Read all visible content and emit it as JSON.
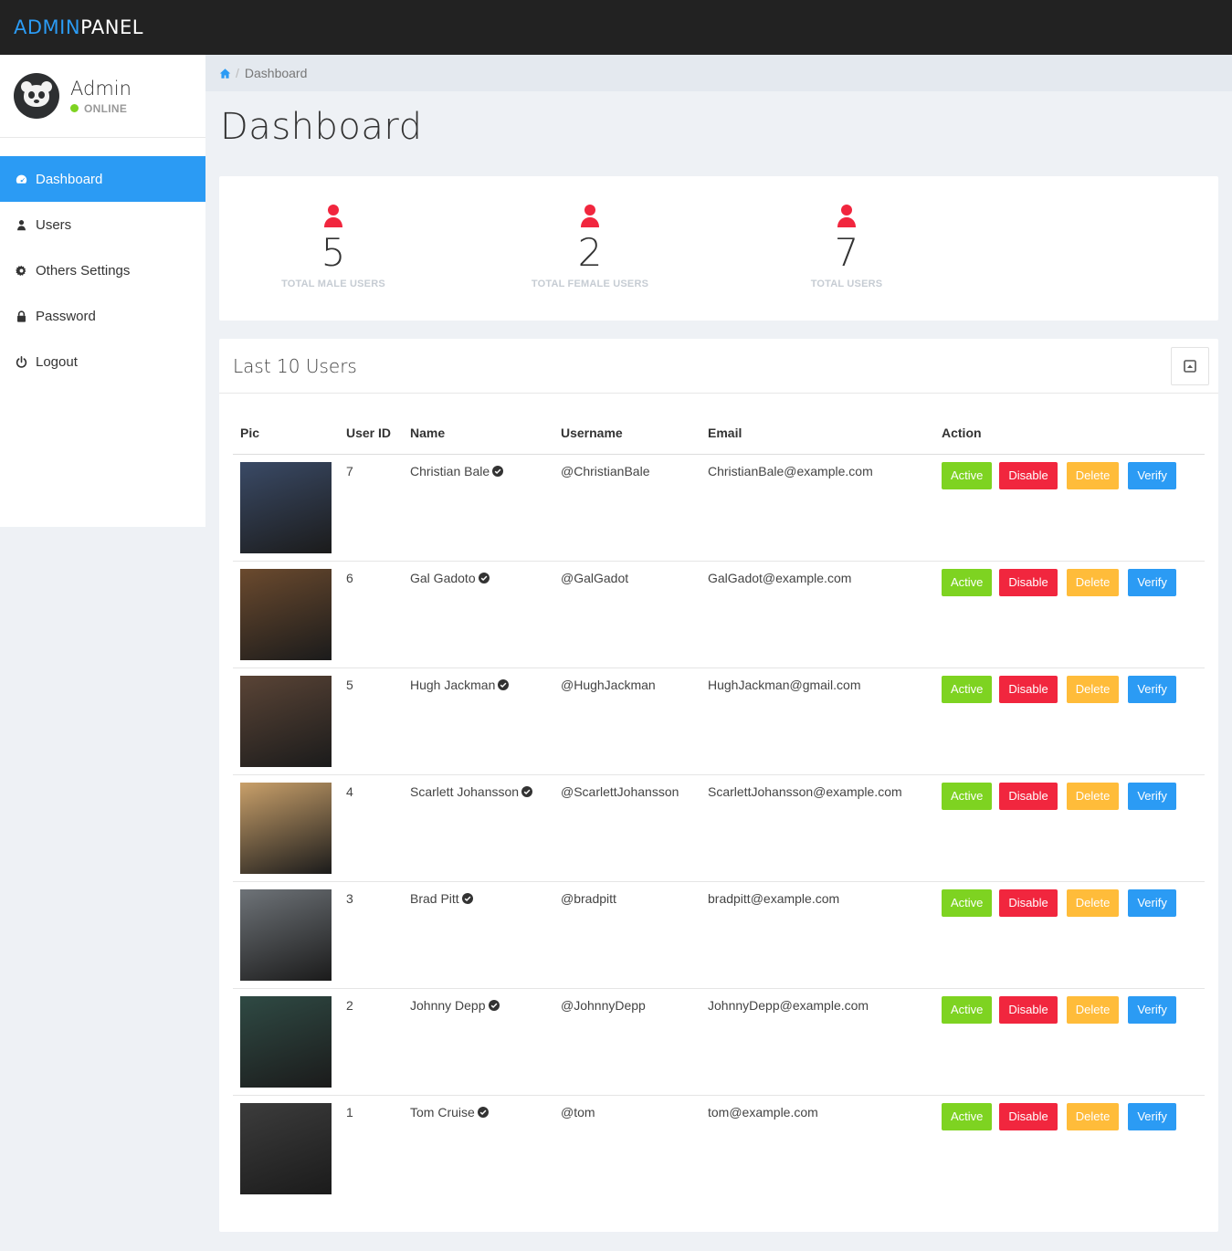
{
  "brand": {
    "part1": "ADMIN",
    "part2": "PANEL"
  },
  "user": {
    "name": "Admin",
    "status": "ONLINE"
  },
  "sidebar": {
    "items": [
      {
        "label": "Dashboard",
        "icon": "dashboard-icon",
        "active": true
      },
      {
        "label": "Users",
        "icon": "user-icon"
      },
      {
        "label": "Others Settings",
        "icon": "gear-icon"
      },
      {
        "label": "Password",
        "icon": "lock-icon"
      },
      {
        "label": "Logout",
        "icon": "power-icon"
      }
    ]
  },
  "breadcrumb": {
    "current": "Dashboard"
  },
  "page": {
    "title": "Dashboard"
  },
  "stats": [
    {
      "value": "5",
      "label": "TOTAL MALE USERS"
    },
    {
      "value": "2",
      "label": "TOTAL FEMALE USERS"
    },
    {
      "value": "7",
      "label": "TOTAL USERS"
    }
  ],
  "users_card": {
    "title": "Last 10 Users",
    "columns": [
      "Pic",
      "User ID",
      "Name",
      "Username",
      "Email",
      "Action"
    ],
    "actions": {
      "active": "Active",
      "disable": "Disable",
      "delete": "Delete",
      "verify": "Verify"
    },
    "rows": [
      {
        "id": "7",
        "name": "Christian Bale",
        "username": "@ChristianBale",
        "email": "ChristianBale@example.com",
        "photo_tone": "#3a4a66"
      },
      {
        "id": "6",
        "name": "Gal Gadoto",
        "username": "@GalGadot",
        "email": "GalGadot@example.com",
        "photo_tone": "#6b4a2e"
      },
      {
        "id": "5",
        "name": "Hugh Jackman",
        "username": "@HughJackman",
        "email": "HughJackman@gmail.com",
        "photo_tone": "#5a4436"
      },
      {
        "id": "4",
        "name": "Scarlett Johansson",
        "username": "@ScarlettJohansson",
        "email": "ScarlettJohansson@example.com",
        "photo_tone": "#c9a06a"
      },
      {
        "id": "3",
        "name": "Brad Pitt",
        "username": "@bradpitt",
        "email": "bradpitt@example.com",
        "photo_tone": "#6e7378"
      },
      {
        "id": "2",
        "name": "Johnny Depp",
        "username": "@JohnnyDepp",
        "email": "JohnnyDepp@example.com",
        "photo_tone": "#2f4a44"
      },
      {
        "id": "1",
        "name": "Tom Cruise",
        "username": "@tom",
        "email": "tom@example.com",
        "photo_tone": "#3c3c3c"
      }
    ]
  },
  "colors": {
    "accent": "#2b9bf4",
    "online": "#7ed321",
    "active": "#7ed321",
    "disable": "#f1263e",
    "delete": "#ffbc3a",
    "verify": "#2b9bf4",
    "stat_icon": "#f1263e"
  }
}
